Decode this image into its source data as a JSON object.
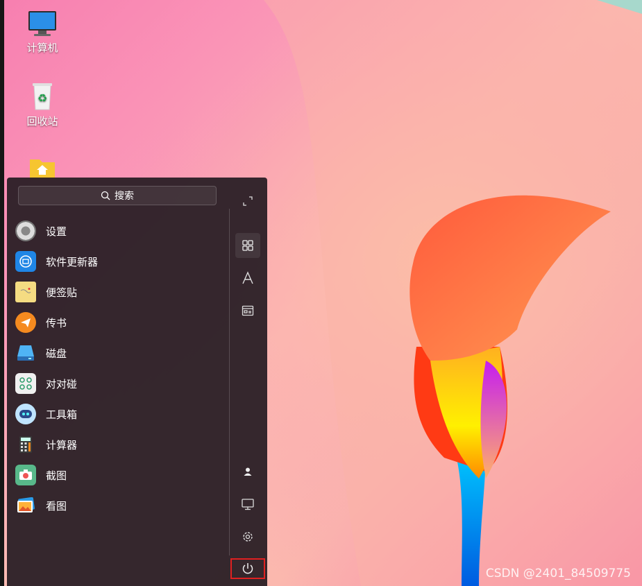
{
  "desktop": {
    "icons": [
      {
        "label": "计算机"
      },
      {
        "label": "回收站"
      },
      {
        "label": ""
      }
    ]
  },
  "menu": {
    "search_label": "搜索",
    "apps": [
      {
        "label": "设置",
        "icon": "settings-gear-icon"
      },
      {
        "label": "软件更新器",
        "icon": "software-updater-icon"
      },
      {
        "label": "便签贴",
        "icon": "sticky-note-icon"
      },
      {
        "label": "传书",
        "icon": "paper-plane-icon"
      },
      {
        "label": "磁盘",
        "icon": "disk-icon"
      },
      {
        "label": "对对碰",
        "icon": "match-game-icon"
      },
      {
        "label": "工具箱",
        "icon": "toolbox-robot-icon"
      },
      {
        "label": "计算器",
        "icon": "calculator-icon"
      },
      {
        "label": "截图",
        "icon": "screenshot-camera-icon"
      },
      {
        "label": "看图",
        "icon": "image-viewer-icon"
      }
    ],
    "side_buttons": [
      "expand-icon",
      "all-apps-grid-icon",
      "alphabetical-icon",
      "category-icon",
      "user-icon",
      "computer-icon",
      "settings-icon",
      "power-icon"
    ]
  },
  "watermark": "CSDN @2401_84509775",
  "colors": {
    "menu_bg": "#281e24",
    "power_highlight": "#e02020",
    "accent": "#ff6a3d"
  }
}
